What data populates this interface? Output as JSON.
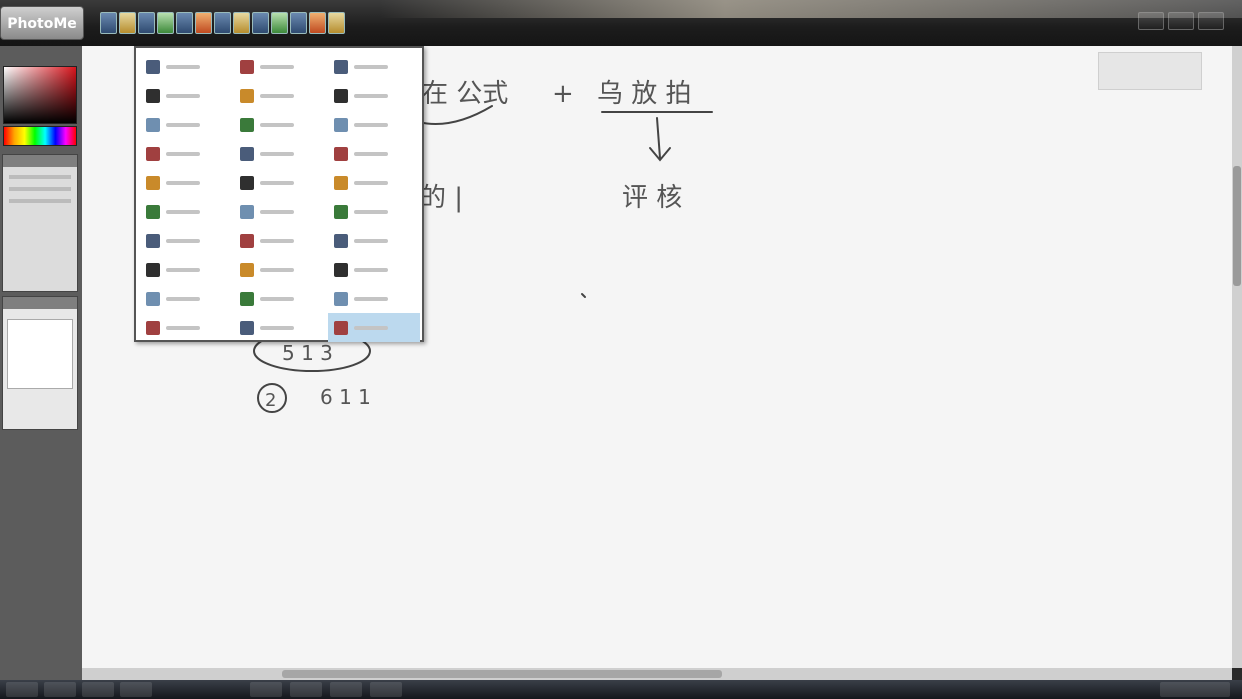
{
  "app": {
    "logo_text": "PhotoMe",
    "toolbar_icons": [
      "pen-tool-icon",
      "brush-icon",
      "eraser-icon",
      "shape-icon",
      "text-icon",
      "color-icon",
      "fill-icon",
      "layers-icon",
      "undo-icon",
      "redo-icon",
      "zoom-icon",
      "settings-icon",
      "export-icon"
    ],
    "window_controls": [
      "minimize-icon",
      "maximize-icon",
      "close-icon"
    ]
  },
  "colors": {
    "ink": "#444444",
    "selection": "#bcd9ee",
    "canvas": "#f5f5f5"
  },
  "canvas_text": {
    "top_formula_a": "在 公式",
    "plus": "+",
    "top_formula_b": "乌 放 拍",
    "arrow": "↓",
    "result_right": "评 核",
    "bracket_left": "的 |",
    "circle_formula": "5 1 3",
    "circled_label": "2",
    "side_label": "6 1 1"
  },
  "menu": {
    "columns": [
      [
        "pen-icon",
        "brush-icon",
        "pencil-icon",
        "line-icon",
        "marker-icon",
        "bucket-icon",
        "gradient-icon",
        "stamp-icon",
        "move-icon",
        "select-icon"
      ],
      [
        "crop-icon",
        "wand-icon",
        "lasso-icon",
        "brush-icon",
        "dropper-icon",
        "smudge-icon",
        "blur-icon",
        "clone-icon",
        "rect-select-icon",
        "triangle-icon"
      ],
      [
        "text-icon",
        "pen-icon",
        "curve-icon",
        "eraser-icon",
        "heal-icon",
        "dodge-icon",
        "burn-icon",
        "sponge-icon",
        "path-icon",
        "hand-icon"
      ]
    ],
    "selected": "2.9"
  }
}
